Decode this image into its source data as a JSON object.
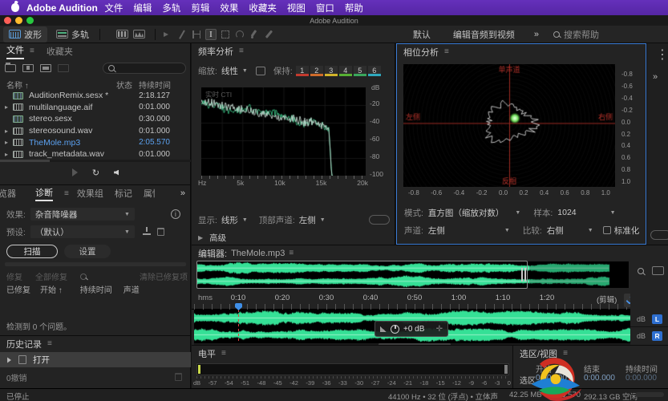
{
  "colors": {
    "accent_blue": "#3f8fe8",
    "selection_blue": "#5ba1f0",
    "wave_green": "#35e096",
    "phase_red": "#9c2a22",
    "trace_light": "#d8efe4",
    "trace_green": "#3fd08f"
  },
  "menubar": {
    "app": "Adobe Audition",
    "items": [
      "文件",
      "编辑",
      "多轨",
      "剪辑",
      "效果",
      "收藏夹",
      "视图",
      "窗口",
      "帮助"
    ]
  },
  "titlebar": {
    "title": "Adobe Audition"
  },
  "toolbar": {
    "waveform": "波形",
    "multitrack": "多轨",
    "workspace_default": "默认",
    "workspace_edit": "编辑音频到视频",
    "more": "»",
    "search": "搜索帮助"
  },
  "files": {
    "tab": "文件",
    "tab2": "收藏夹",
    "col_name": "名称",
    "col_status": "状态",
    "col_duration": "持续时间",
    "rows": [
      {
        "name": "AuditionRemix.sesx *",
        "duration": "2:18.127",
        "kind": "sesx",
        "chevron": false,
        "selected": false
      },
      {
        "name": "multilanguage.aif",
        "duration": "0:01.000",
        "kind": "wave",
        "chevron": true,
        "selected": false
      },
      {
        "name": "stereo.sesx",
        "duration": "0:30.000",
        "kind": "sesx",
        "chevron": false,
        "selected": false
      },
      {
        "name": "stereosound.wav",
        "duration": "0:01.000",
        "kind": "wave",
        "chevron": true,
        "selected": false
      },
      {
        "name": "TheMole.mp3",
        "duration": "2:05.570",
        "kind": "wave",
        "chevron": true,
        "selected": true
      },
      {
        "name": "track_metadata.wav",
        "duration": "0:01.000",
        "kind": "wave",
        "chevron": true,
        "selected": false
      }
    ]
  },
  "freq": {
    "title": "频率分析",
    "scale_label": "缩放:",
    "scale_value": "线性",
    "hold_label": "保持:",
    "holds": [
      {
        "n": "1",
        "c": "#c33a2e"
      },
      {
        "n": "2",
        "c": "#cf6b2a"
      },
      {
        "n": "3",
        "c": "#d2b32a"
      },
      {
        "n": "4",
        "c": "#56b033"
      },
      {
        "n": "5",
        "c": "#3aa65c"
      },
      {
        "n": "6",
        "c": "#2fa8bd"
      }
    ],
    "graph_label": "实时 CTI",
    "db_label": "dB",
    "yticks": [
      "-20",
      "-40",
      "-60",
      "-80",
      "-100"
    ],
    "xticks": [
      "Hz",
      "5k",
      "10k",
      "15k",
      "20k"
    ],
    "display_label": "显示:",
    "display_value": "线形",
    "top_label": "顶部声道:",
    "top_value": "左侧",
    "advanced": "高级"
  },
  "phase": {
    "title": "相位分析",
    "label_top": "单声道",
    "label_left": "左侧",
    "label_right": "右侧",
    "label_bottom": "反相",
    "yticks": [
      "-0.8",
      "-0.6",
      "-0.4",
      "-0.2",
      "0.0",
      "0.2",
      "0.4",
      "0.6",
      "0.8",
      "1.0"
    ],
    "xticks": [
      "-0.8",
      "-0.6",
      "-0.4",
      "-0.2",
      "0.0",
      "0.2",
      "0.4",
      "0.6",
      "0.8",
      "1.0"
    ],
    "mode_label": "模式:",
    "mode_value": "直方图（缩放对数）",
    "samples_label": "样本:",
    "samples_value": "1024",
    "channel_label": "声道:",
    "channel_value": "左侧",
    "compare_label": "比较:",
    "compare_value": "右侧",
    "normalize": "标准化"
  },
  "diag": {
    "tab_browser": "览器",
    "tab_diag": "诊断",
    "tab_fx": "效果组",
    "tab_markers": "标记",
    "tab_props": "属性",
    "more": "»",
    "effect_label": "效果:",
    "effect_value": "杂音降噪器",
    "preset_label": "预设:",
    "preset_value": "（默认）",
    "scan": "扫描",
    "settings": "设置",
    "repair": "修复",
    "repair_all": "全部修复",
    "clear": "清除已修复项",
    "col_fixed": "已修复",
    "col_start": "开始",
    "col_dur": "持续时间",
    "col_ch": "声道",
    "status": "检测到 0 个问题。"
  },
  "history": {
    "title": "历史记录",
    "entry": "打开",
    "undo": "0撤销"
  },
  "editor": {
    "label": "编辑器:",
    "file": "TheMole.mp3",
    "unit": "hms",
    "ticks": [
      "0:10",
      "0:20",
      "0:30",
      "0:40",
      "0:50",
      "1:00",
      "1:10",
      "1:20"
    ],
    "clip": "(剪辑)",
    "hud": "+0 dB",
    "db_l": "dB",
    "db_r": "dB",
    "badge_l": "L",
    "badge_r": "R"
  },
  "levels": {
    "title": "电平",
    "scale": [
      "dB",
      "-57",
      "-54",
      "-51",
      "-48",
      "-45",
      "-42",
      "-39",
      "-36",
      "-33",
      "-30",
      "-27",
      "-24",
      "-21",
      "-18",
      "-15",
      "-12",
      "-9",
      "-6",
      "-3",
      "0"
    ]
  },
  "selview": {
    "title": "选区/视图",
    "col_start": "开始",
    "col_end": "结束",
    "col_dur": "持续时间",
    "row_label": "选区",
    "start": "0:00.000",
    "end": "0:00.000",
    "duration": "0:00.000"
  },
  "status": {
    "state": "已停止",
    "format": "44100 Hz • 32 位 (浮点) • 立体声",
    "size": "42.25 MB",
    "time": "2:05.570",
    "free": "292.13 GB 空闲"
  }
}
